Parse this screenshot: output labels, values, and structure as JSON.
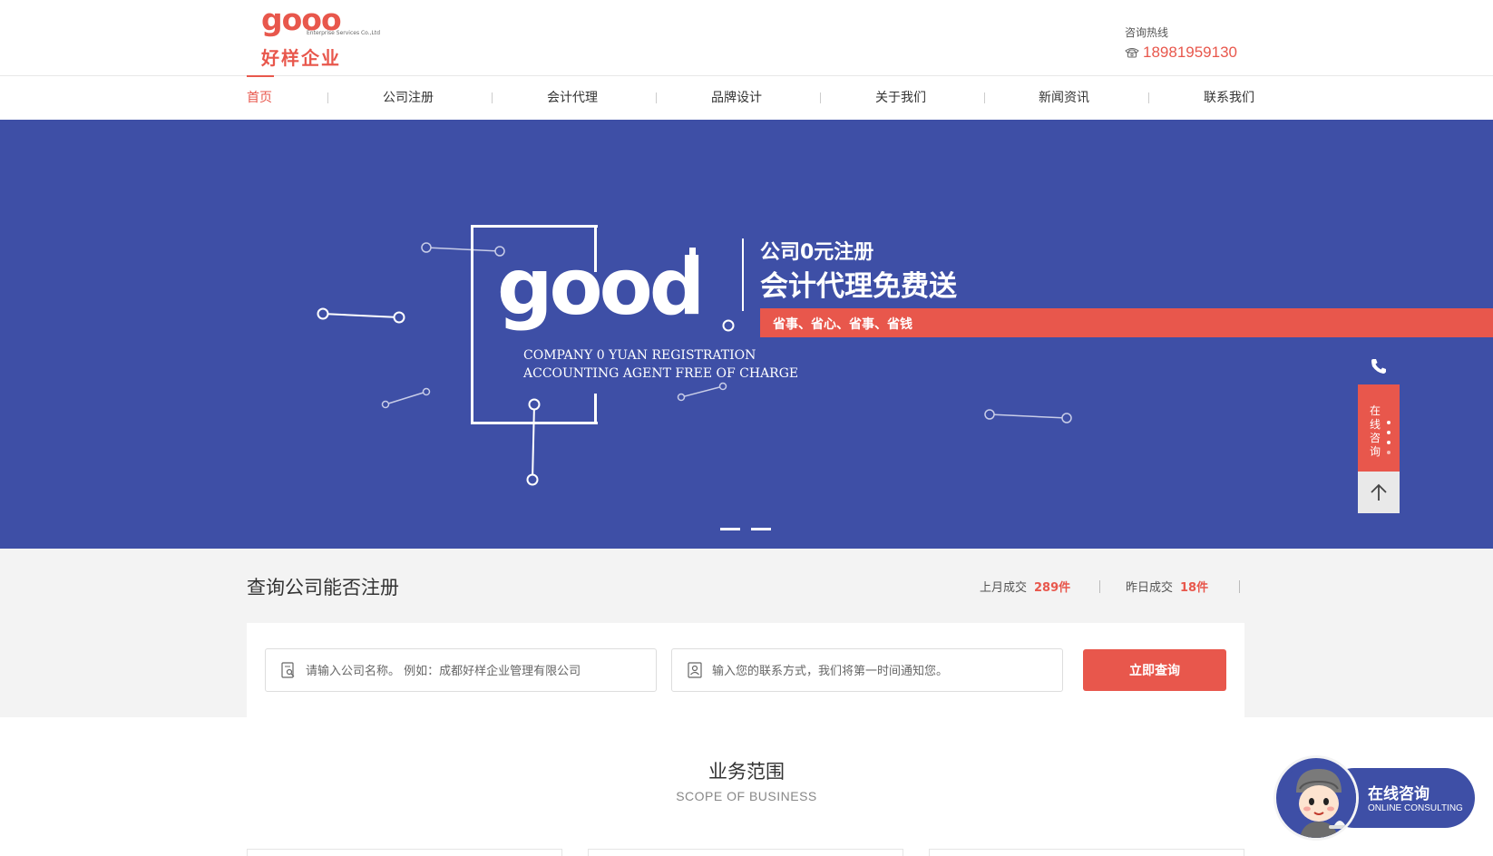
{
  "header": {
    "logo_mark": "gooo",
    "logo_sub": "Enterprise Services Co.,Ltd",
    "logo_cn": "好样企业",
    "hotline_label": "咨询热线",
    "hotline_number": "18981959130"
  },
  "nav": {
    "items": [
      {
        "label": "首页",
        "active": true
      },
      {
        "label": "公司注册"
      },
      {
        "label": "会计代理"
      },
      {
        "label": "品牌设计"
      },
      {
        "label": "关于我们"
      },
      {
        "label": "新闻资讯"
      },
      {
        "label": "联系我们"
      }
    ]
  },
  "banner": {
    "logo_text": "good",
    "en_line1": "COMPANY 0 YUAN REGISTRATION",
    "en_line2": "ACCOUNTING AGENT FREE OF CHARGE",
    "title1": "公司0元注册",
    "title2": "会计代理免费送",
    "strip": "省事、省心、省事、省钱",
    "slides": 2
  },
  "side": {
    "consult": "在线咨询"
  },
  "query": {
    "title": "查询公司能否注册",
    "stat1_label": "上月成交",
    "stat1_value": "289件",
    "stat2_label": "昨日成交",
    "stat2_value": "18件",
    "company_placeholder": "请输入公司名称。 例如：成都好样企业管理有限公司",
    "contact_placeholder": "输入您的联系方式，我们将第一时间通知您。",
    "button": "立即查询"
  },
  "business": {
    "title": "业务范围",
    "subtitle": "SCOPE OF BUSINESS"
  },
  "float_consult": {
    "title": "在线咨询",
    "subtitle": "ONLINE CONSULTING"
  },
  "colors": {
    "accent": "#e8574c",
    "brand_blue": "#3e4fa6"
  }
}
